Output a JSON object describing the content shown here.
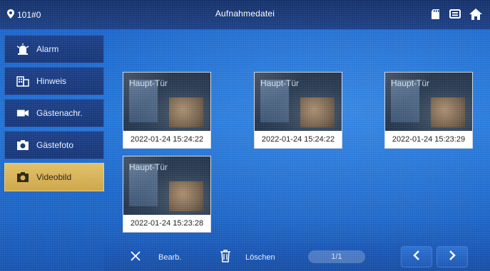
{
  "header": {
    "room": "101#0",
    "title": "Aufnahmedatei"
  },
  "sidebar": {
    "items": [
      {
        "label": "Alarm",
        "icon": "alarm-icon"
      },
      {
        "label": "Hinweis",
        "icon": "notice-icon"
      },
      {
        "label": "Gästenachr.",
        "icon": "video-camera-icon"
      },
      {
        "label": "Gästefoto",
        "icon": "camera-icon"
      },
      {
        "label": "Videobild",
        "icon": "video-icon"
      }
    ],
    "active_index": 4
  },
  "recordings": [
    {
      "overlay_text": "Haupt-Tür",
      "datetime": "2022-01-24 15:24:22"
    },
    {
      "overlay_text": "Haupt-Tür",
      "datetime": "2022-01-24 15:24:22"
    },
    {
      "overlay_text": "Haupt-Tür",
      "datetime": "2022-01-24 15:23:29"
    },
    {
      "overlay_text": "Haupt-Tür",
      "datetime": "2022-01-24 15:23:28"
    }
  ],
  "toolbar": {
    "edit_label": "Bearb.",
    "delete_label": "Löschen",
    "page_indicator": "1/1"
  },
  "colors": {
    "top_bar": "#1b3f86",
    "sidebar_item": "#1a3e88",
    "active_item": "#d6b35a",
    "background": "#1f72d6"
  }
}
